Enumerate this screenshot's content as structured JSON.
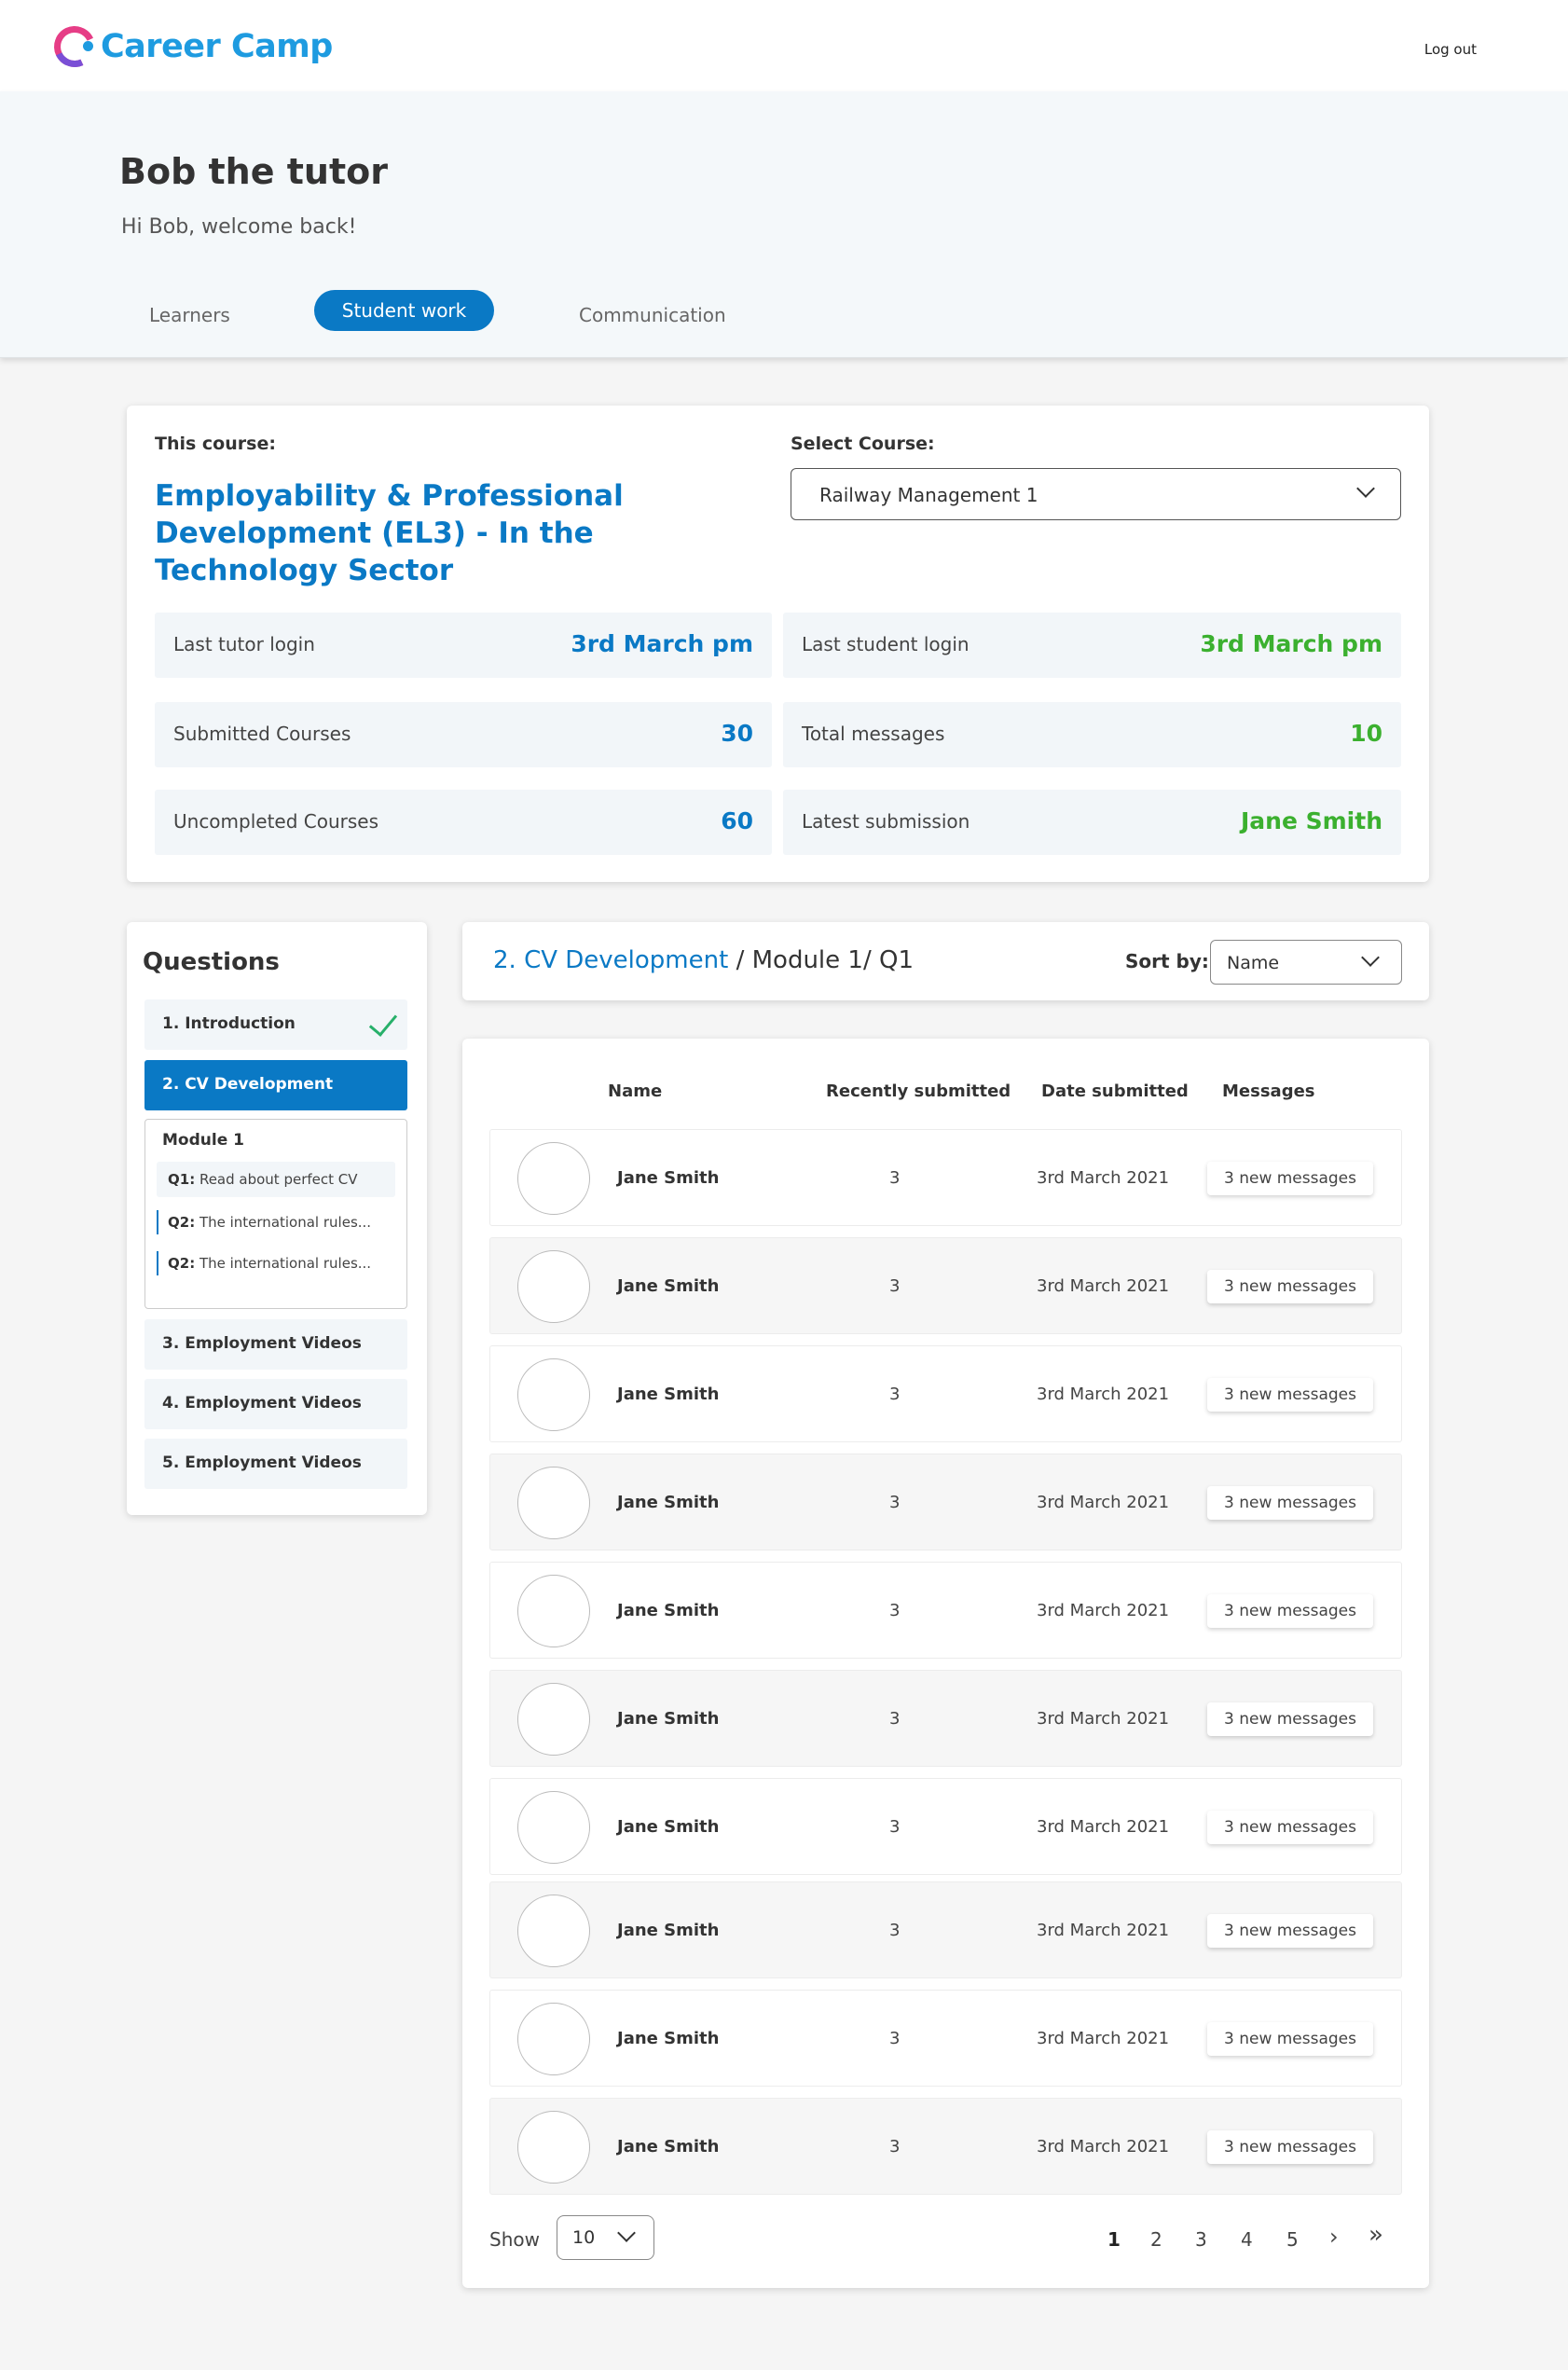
{
  "brand": {
    "name": "Career Camp"
  },
  "topbar": {
    "logout_label": "Log out"
  },
  "header": {
    "title": "Bob the tutor",
    "welcome": "Hi Bob, welcome back!",
    "tabs": [
      "Learners",
      "Student work",
      "Communication"
    ],
    "active_tab": "Student work"
  },
  "course": {
    "this_course_label": "This course:",
    "course_title": "Employability & Professional Development (EL3) - In the Technology Sector",
    "select_label": "Select Course:",
    "selected_course": "Railway Management 1",
    "stats": [
      {
        "label": "Last tutor login",
        "value": "3rd March pm"
      },
      {
        "label": "Last student login",
        "value": "3rd March pm"
      },
      {
        "label": "Submitted Courses",
        "value": "30"
      },
      {
        "label": "Total messages",
        "value": "10"
      },
      {
        "label": "Uncompleted Courses",
        "value": "60"
      },
      {
        "label": "Latest submission",
        "value": "Jane Smith"
      }
    ]
  },
  "questions": {
    "title": "Questions",
    "items": [
      {
        "label": "1. Introduction",
        "completed": true
      },
      {
        "label": "2. CV Development",
        "active": true
      },
      {
        "label": "3. Employment Videos"
      },
      {
        "label": "4. Employment Videos"
      },
      {
        "label": "5. Employment Videos"
      }
    ],
    "module": {
      "title": "Module 1",
      "subs": [
        {
          "prefix": "Q1:",
          "text": " Read about perfect CV"
        },
        {
          "prefix": "Q2:",
          "text": " The international rules..."
        },
        {
          "prefix": "Q2:",
          "text": " The international rules..."
        }
      ]
    }
  },
  "breadcrumb": {
    "part1": "2. CV Development",
    "separator": " / ",
    "part2": "Module 1/ Q1"
  },
  "sort": {
    "label": "Sort by:",
    "value": "Name"
  },
  "table": {
    "headers": [
      "Name",
      "Recently submitted",
      "Date submitted",
      "Messages"
    ],
    "rows": [
      {
        "name": "Jane Smith",
        "count": "3",
        "date": "3rd March 2021",
        "messages": "3 new messages"
      },
      {
        "name": "Jane Smith",
        "count": "3",
        "date": "3rd March 2021",
        "messages": "3 new messages"
      },
      {
        "name": "Jane Smith",
        "count": "3",
        "date": "3rd March 2021",
        "messages": "3 new messages"
      },
      {
        "name": "Jane Smith",
        "count": "3",
        "date": "3rd March 2021",
        "messages": "3 new messages"
      },
      {
        "name": "Jane Smith",
        "count": "3",
        "date": "3rd March 2021",
        "messages": "3 new messages"
      },
      {
        "name": "Jane Smith",
        "count": "3",
        "date": "3rd March 2021",
        "messages": "3 new messages"
      },
      {
        "name": "Jane Smith",
        "count": "3",
        "date": "3rd March 2021",
        "messages": "3 new messages"
      },
      {
        "name": "Jane Smith",
        "count": "3",
        "date": "3rd March 2021",
        "messages": "3 new messages"
      },
      {
        "name": "Jane Smith",
        "count": "3",
        "date": "3rd March 2021",
        "messages": "3 new messages"
      },
      {
        "name": "Jane Smith",
        "count": "3",
        "date": "3rd March 2021",
        "messages": "3 new messages"
      }
    ]
  },
  "pagination": {
    "show_label": "Show",
    "page_size": "10",
    "pages": [
      "1",
      "2",
      "3",
      "4",
      "5"
    ],
    "current": "1",
    "next": "›",
    "last": "»"
  },
  "colors": {
    "accent": "#0a79c5",
    "success": "#3bb02f",
    "check": "#27b06a"
  }
}
